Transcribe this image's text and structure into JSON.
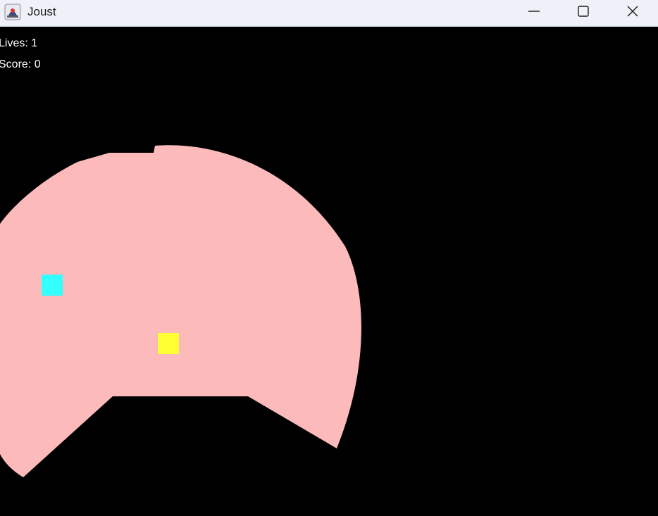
{
  "window": {
    "title": "Joust"
  },
  "hud": {
    "lives_label": "Lives: 1",
    "score_label": "Score: 0"
  },
  "colors": {
    "arena": "#fcbaba",
    "player": "#33ffff",
    "enemy": "#ffff33",
    "background": "#000000",
    "hud_text": "#ffffff"
  }
}
